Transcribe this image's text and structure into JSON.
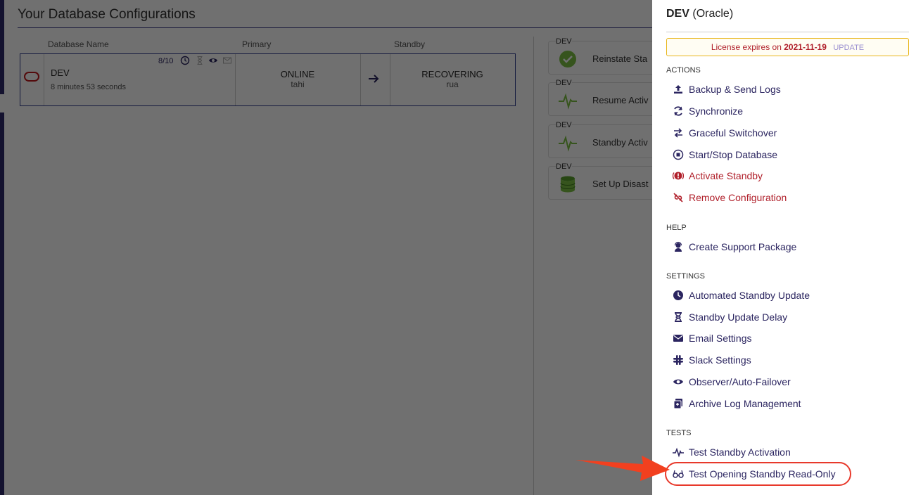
{
  "main": {
    "title": "Your Database Configurations",
    "columns": {
      "name": "Database Name",
      "primary": "Primary",
      "standby": "Standby"
    },
    "config": {
      "name": "DEV",
      "elapsed": "8 minutes 53 seconds",
      "count": "8/10",
      "primary_state": "ONLINE",
      "primary_host": "tahi",
      "standby_state": "RECOVERING",
      "standby_host": "rua"
    },
    "cards": [
      {
        "tag": "DEV",
        "label": "Reinstate Sta",
        "icon": "check-icon"
      },
      {
        "tag": "DEV",
        "label": "Resume Activ",
        "icon": "pulse-icon"
      },
      {
        "tag": "DEV",
        "label": "Standby Activ",
        "icon": "pulse-icon"
      },
      {
        "tag": "DEV",
        "label": "Set Up Disast",
        "icon": "database-icon"
      }
    ]
  },
  "panel": {
    "title_bold": "DEV",
    "title_rest": "(Oracle)",
    "license": {
      "prefix": "License expires on",
      "date": "2021-11-19",
      "action": "UPDATE"
    },
    "sections": {
      "actions": "ACTIONS",
      "help": "HELP",
      "settings": "SETTINGS",
      "tests": "TESTS"
    },
    "actions": [
      {
        "label": "Backup & Send Logs",
        "icon": "upload-icon"
      },
      {
        "label": "Synchronize",
        "icon": "sync-icon"
      },
      {
        "label": "Graceful Switchover",
        "icon": "switch-icon"
      },
      {
        "label": "Start/Stop Database",
        "icon": "stop-icon"
      },
      {
        "label": "Activate Standby",
        "icon": "alert-icon"
      },
      {
        "label": "Remove Configuration",
        "icon": "unlink-icon"
      }
    ],
    "help": [
      {
        "label": "Create Support Package",
        "icon": "support-icon"
      }
    ],
    "settings": [
      {
        "label": "Automated Standby Update",
        "icon": "clock-icon"
      },
      {
        "label": "Standby Update Delay",
        "icon": "hourglass-icon"
      },
      {
        "label": "Email Settings",
        "icon": "envelope-icon"
      },
      {
        "label": "Slack Settings",
        "icon": "slack-icon"
      },
      {
        "label": "Observer/Auto-Failover",
        "icon": "eye-icon"
      },
      {
        "label": "Archive Log Management",
        "icon": "archive-icon"
      }
    ],
    "tests": [
      {
        "label": "Test Standby Activation",
        "icon": "pulse-icon"
      },
      {
        "label": "Test Opening Standby Read-Only",
        "icon": "glasses-icon"
      }
    ]
  },
  "colors": {
    "accent": "#2b2560",
    "danger": "#b01f2a",
    "highlight": "#e8392b",
    "license_border": "#e8b61a"
  }
}
